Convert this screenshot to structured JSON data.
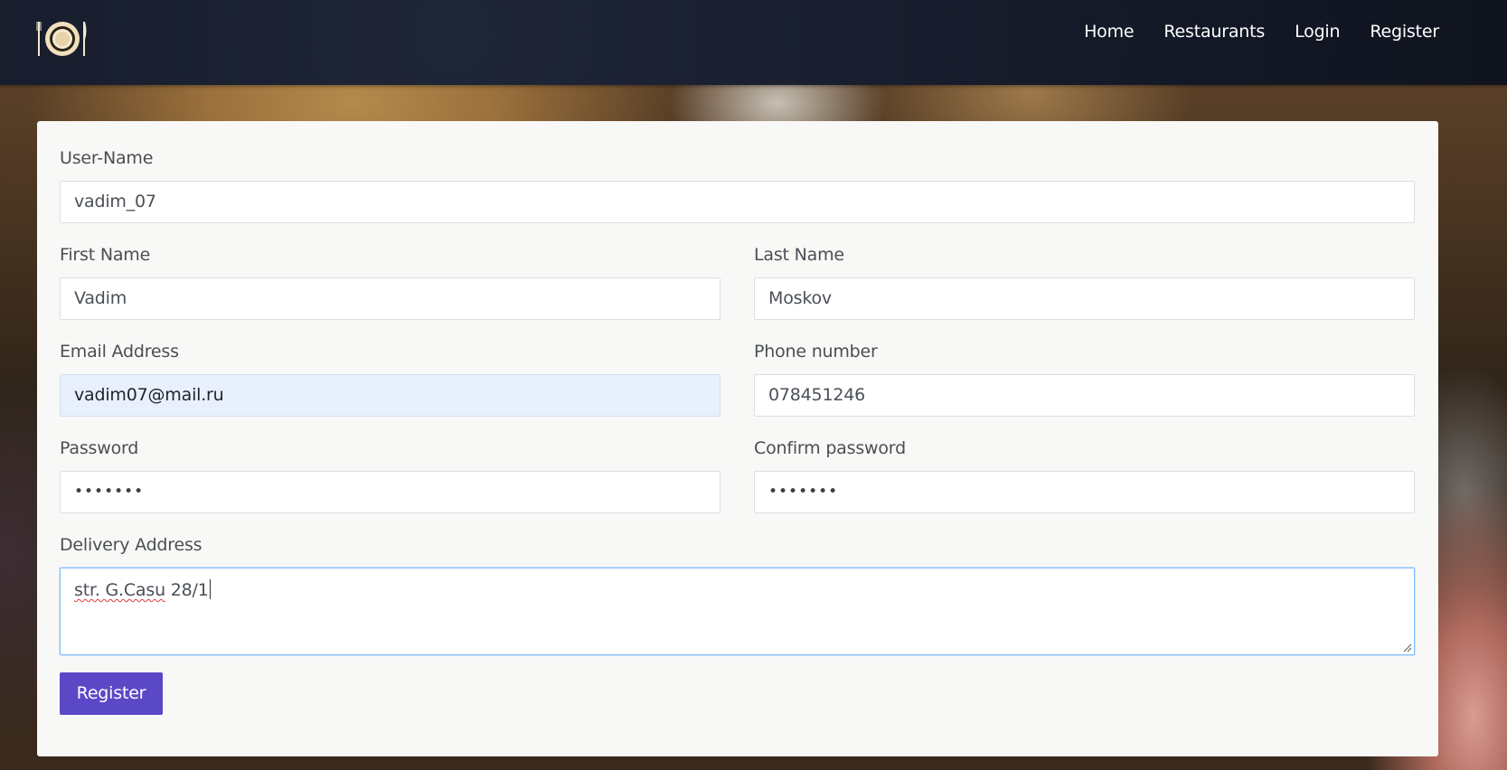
{
  "nav": {
    "logo_icon": "plate-fork-knife-icon",
    "links": [
      "Home",
      "Restaurants",
      "Login",
      "Register"
    ]
  },
  "form": {
    "username": {
      "label": "User-Name",
      "value": "vadim_07"
    },
    "first_name": {
      "label": "First Name",
      "value": "Vadim"
    },
    "last_name": {
      "label": "Last Name",
      "value": "Moskov"
    },
    "email": {
      "label": "Email Address",
      "value": "vadim07@mail.ru"
    },
    "phone": {
      "label": "Phone number",
      "value": "078451246"
    },
    "password": {
      "label": "Password",
      "value": "•••••••"
    },
    "confirm_password": {
      "label": "Confirm password",
      "value": "•••••••"
    },
    "delivery_address": {
      "label": "Delivery Address",
      "value_part1": "str. G.Casu",
      "value_part2": " 28/1"
    },
    "submit_label": "Register"
  },
  "colors": {
    "navbar": "#141a28",
    "card": "#f8f8f6",
    "button": "#5b48c7",
    "autofill": "#e8f0fe",
    "focus_border": "#80bdff"
  }
}
